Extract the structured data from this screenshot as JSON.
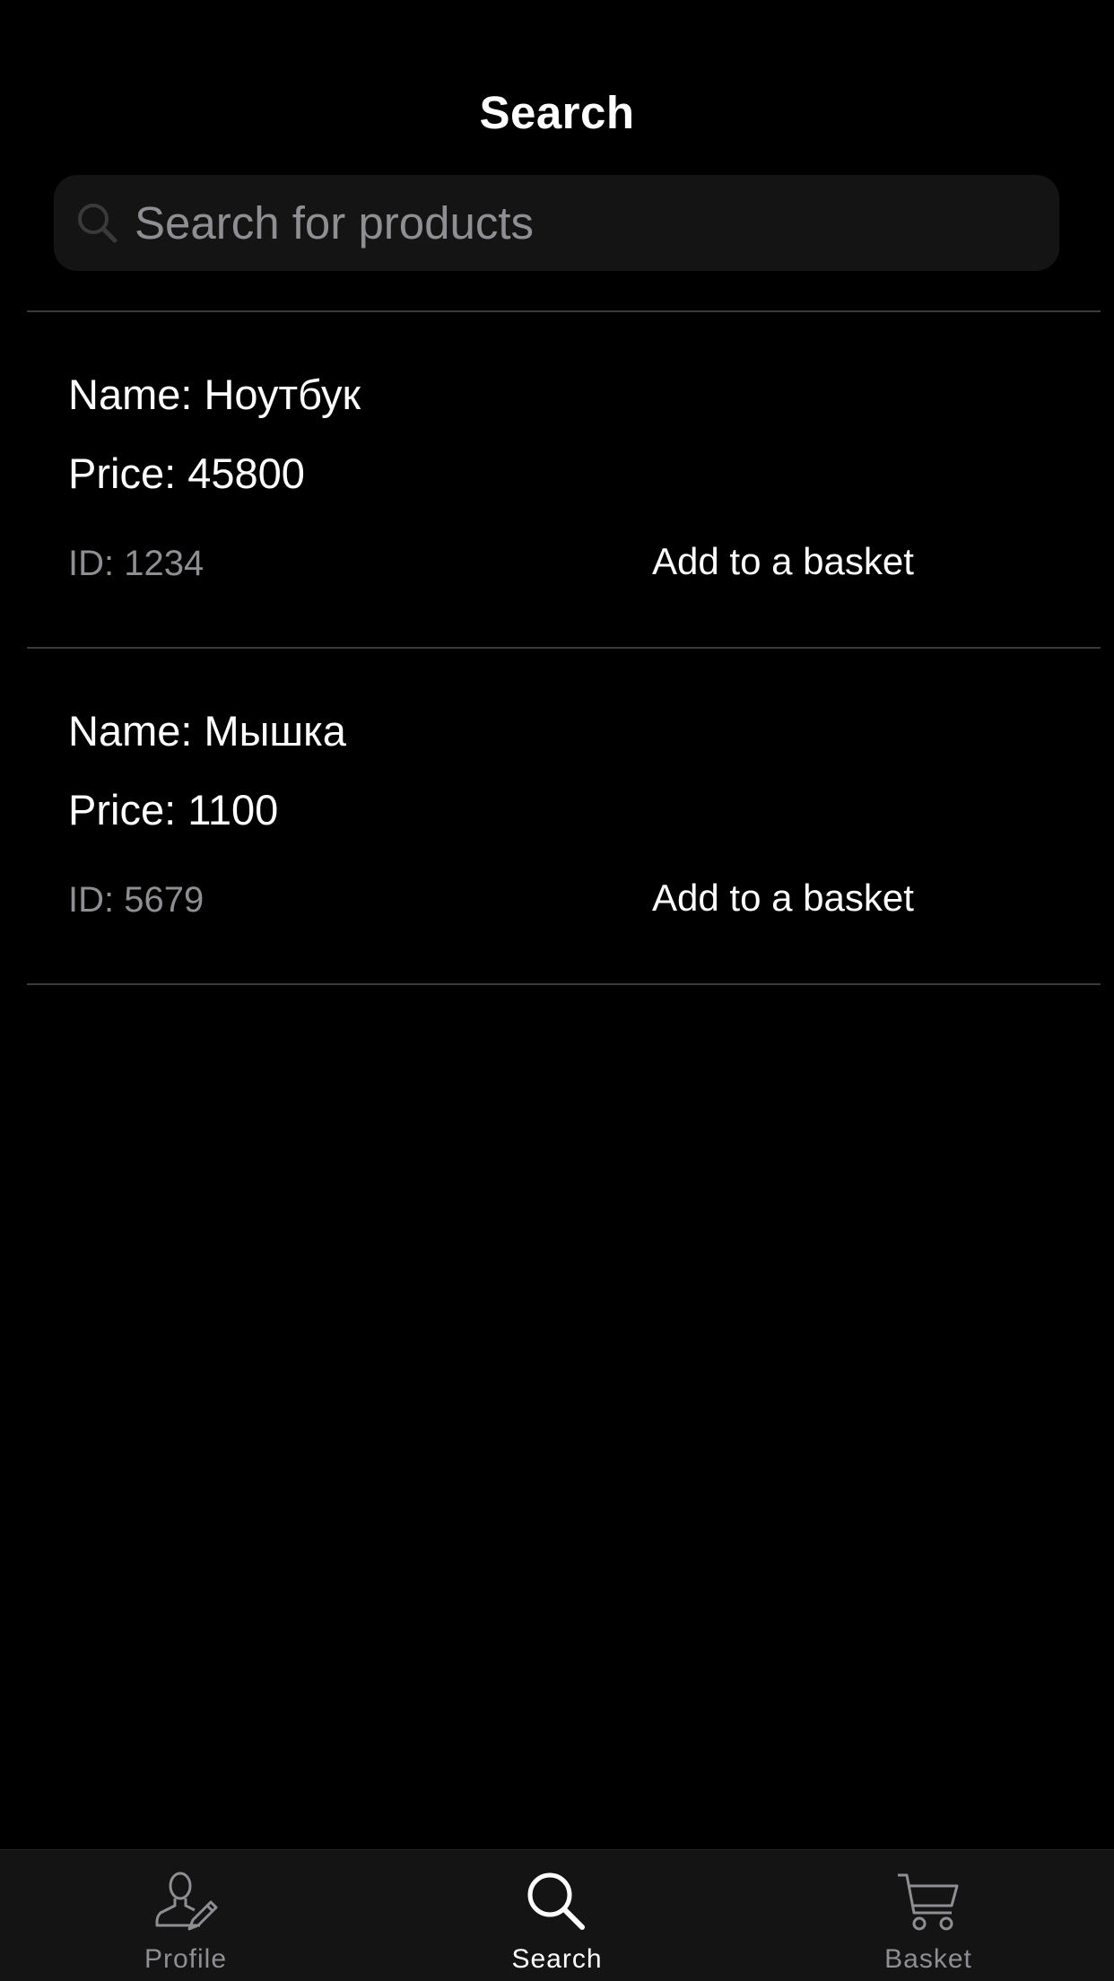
{
  "header": {
    "title": "Search"
  },
  "search": {
    "placeholder": "Search for products",
    "value": ""
  },
  "products": [
    {
      "name": "Name: Ноутбук",
      "price": "Price: 45800",
      "id": "ID: 1234",
      "action_label": "Add to a basket"
    },
    {
      "name": "Name: Мышка",
      "price": "Price: 1100",
      "id": "ID: 5679",
      "action_label": "Add to a basket"
    }
  ],
  "tab_bar": {
    "items": [
      {
        "label": "Profile",
        "icon": "profile-edit-icon",
        "active": false
      },
      {
        "label": "Search",
        "icon": "search-icon",
        "active": true
      },
      {
        "label": "Basket",
        "icon": "cart-icon",
        "active": false
      }
    ]
  },
  "colors": {
    "background": "#000000",
    "surface": "#141414",
    "text_primary": "#ffffff",
    "text_secondary": "#8e8e93",
    "separator": "#3a3a3c"
  }
}
